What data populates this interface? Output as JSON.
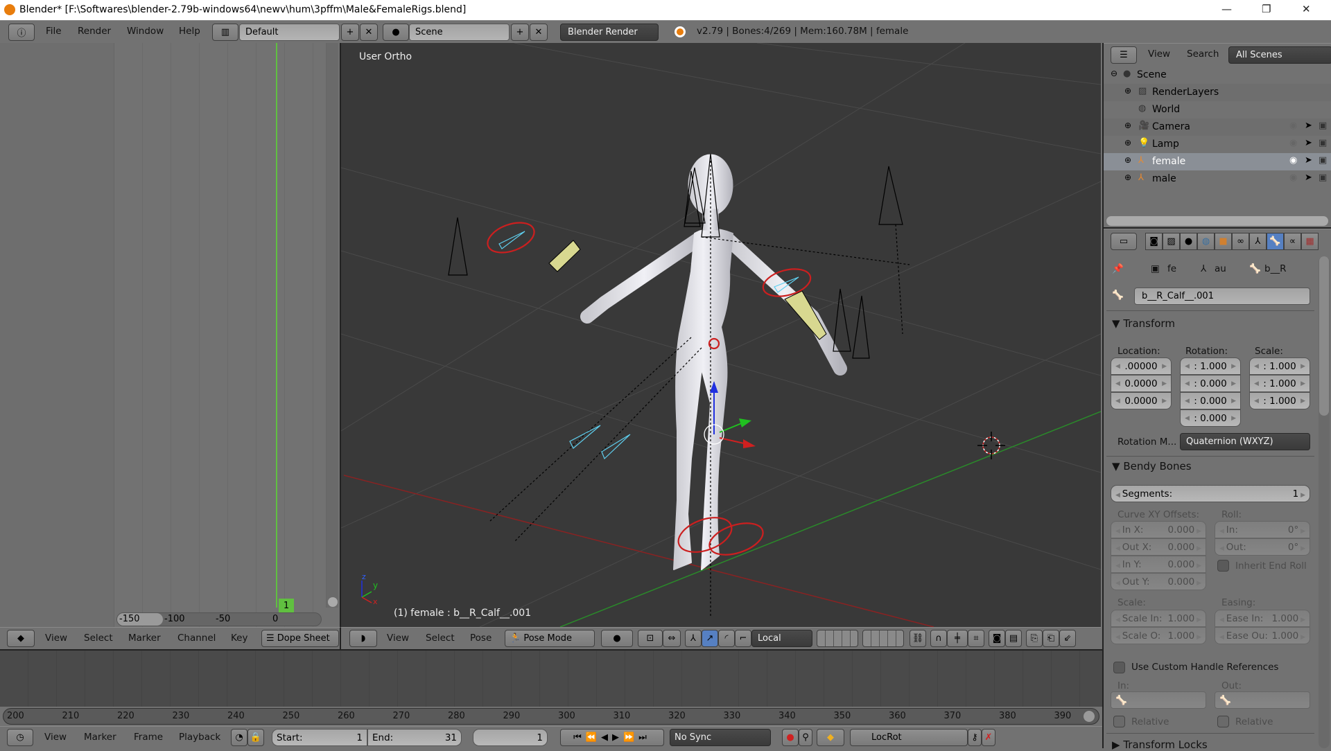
{
  "window": {
    "title": "Blender* [F:\\Softwares\\blender-2.79b-windows64\\newv\\hum\\3pffm\\Male&FemaleRigs.blend]",
    "minimize": "—",
    "maximize": "❐",
    "close": "✕"
  },
  "top_header": {
    "menus": [
      "File",
      "Render",
      "Window",
      "Help"
    ],
    "layout": "Default",
    "scene": "Scene",
    "engine": "Blender Render",
    "stats": "v2.79 | Bones:4/269  | Mem:160.78M | female",
    "add": "+",
    "remove": "✕"
  },
  "dopesheet": {
    "frame_badge": "1",
    "ruler": [
      "-150",
      "-100",
      "-50",
      "0"
    ],
    "menus": [
      "View",
      "Select",
      "Marker",
      "Channel",
      "Key"
    ],
    "mode": "Dope Sheet"
  },
  "viewport": {
    "view_label": "User Ortho",
    "status": "(1) female : b__R_Calf__.001",
    "axis_z": "z",
    "axis_y": "y",
    "axis_x": "x",
    "menus": [
      "View",
      "Select",
      "Pose"
    ],
    "mode": "Pose Mode",
    "orientation": "Local",
    "colors": {
      "background": "#393939",
      "selection_circle": "#cc1f1f",
      "selected_bone": "#5fd0f0",
      "active_bone_fill": "#d8d890",
      "x_axis": "#a02020",
      "y_axis": "#2a8a2a"
    }
  },
  "timeline": {
    "ruler": [
      "200",
      "210",
      "220",
      "230",
      "240",
      "250",
      "260",
      "270",
      "280",
      "290",
      "300",
      "310",
      "320",
      "330",
      "340",
      "350",
      "360",
      "370",
      "380",
      "390"
    ],
    "menus": [
      "View",
      "Marker",
      "Frame",
      "Playback"
    ],
    "start_label": "Start:",
    "start": "1",
    "end_label": "End:",
    "end": "31",
    "current": "1",
    "sync": "No Sync",
    "keying_set": "LocRot"
  },
  "outliner": {
    "menus": [
      "View",
      "Search"
    ],
    "filter": "All Scenes",
    "items": [
      {
        "label": "Scene",
        "icon": "scene-icon"
      },
      {
        "label": "RenderLayers",
        "icon": "render-layers-icon"
      },
      {
        "label": "World",
        "icon": "world-icon"
      },
      {
        "label": "Camera",
        "icon": "camera-icon"
      },
      {
        "label": "Lamp",
        "icon": "lamp-icon"
      },
      {
        "label": "female",
        "icon": "armature-icon",
        "selected": true
      },
      {
        "label": "male",
        "icon": "armature-icon"
      }
    ]
  },
  "properties": {
    "breadcrumb": [
      "fe",
      "au",
      "b__R"
    ],
    "bone_name": "b__R_Calf__.001",
    "transform": {
      "title": "Transform",
      "location_label": "Location:",
      "rotation_label": "Rotation:",
      "scale_label": "Scale:",
      "location": [
        ".00000",
        "0.0000",
        "0.0000"
      ],
      "rotation": [
        ":  1.000",
        ":  0.000",
        ":  0.000",
        ":  0.000"
      ],
      "scale": [
        ":  1.000",
        ":  1.000",
        ":  1.000"
      ],
      "rotation_mode_label": "Rotation M...",
      "rotation_mode": "Quaternion (WXYZ)"
    },
    "bendy": {
      "title": "Bendy Bones",
      "segments_label": "Segments:",
      "segments": "1",
      "curve_label": "Curve XY Offsets:",
      "roll_label": "Roll:",
      "curve": [
        {
          "l": "In X:",
          "v": "0.000"
        },
        {
          "l": "Out X:",
          "v": "0.000"
        },
        {
          "l": "In Y:",
          "v": "0.000"
        },
        {
          "l": "Out Y:",
          "v": "0.000"
        }
      ],
      "roll": [
        {
          "l": "In:",
          "v": "0°"
        },
        {
          "l": "Out:",
          "v": "0°"
        }
      ],
      "inherit_end_roll": "Inherit End Roll",
      "scale_label": "Scale:",
      "easing_label": "Easing:",
      "scale": [
        {
          "l": "Scale In:",
          "v": "1.000"
        },
        {
          "l": "Scale O:",
          "v": "1.000"
        }
      ],
      "easing": [
        {
          "l": "Ease In:",
          "v": "1.000"
        },
        {
          "l": "Ease Ou:",
          "v": "1.000"
        }
      ],
      "custom_handle": "Use Custom Handle References",
      "in_label": "In:",
      "out_label": "Out:",
      "relative": "Relative"
    },
    "transform_locks": "Transform Locks"
  }
}
